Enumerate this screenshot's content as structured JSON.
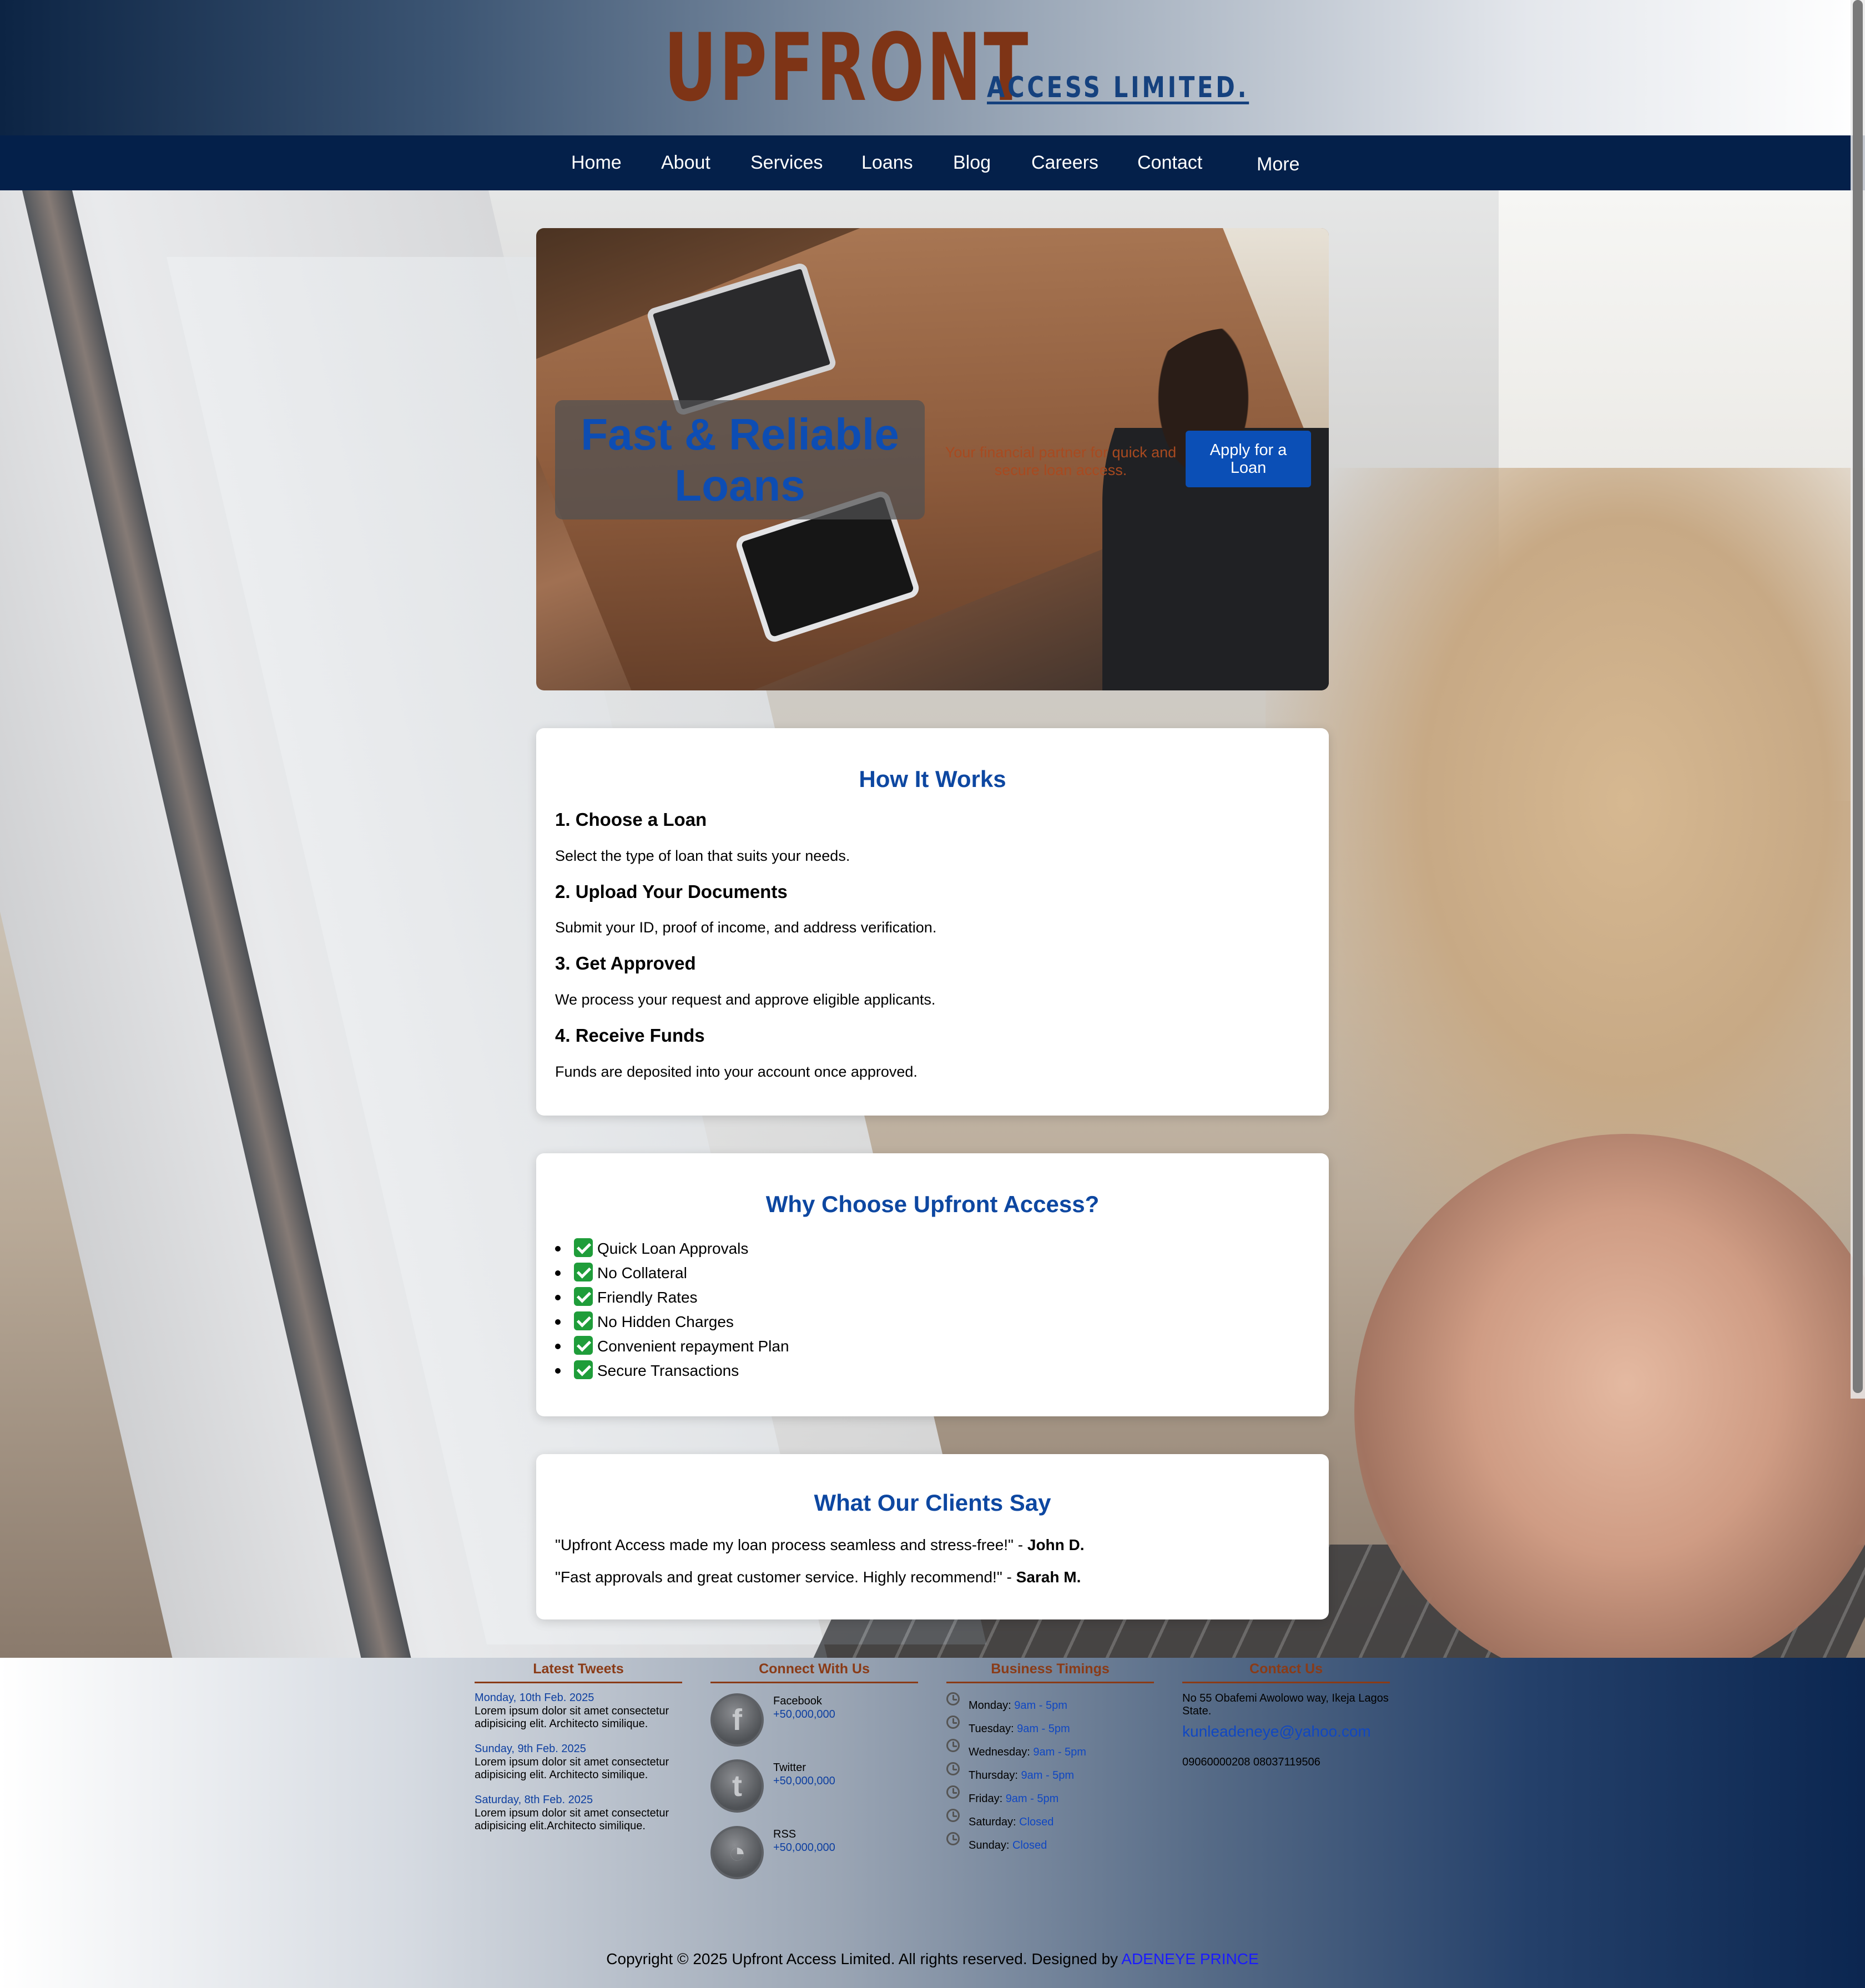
{
  "brand": {
    "name": "UPFRONT",
    "sub": "ACCESS LIMITED."
  },
  "nav": {
    "items": [
      {
        "label": "Home"
      },
      {
        "label": "About"
      },
      {
        "label": "Services"
      },
      {
        "label": "Loans"
      },
      {
        "label": "Blog"
      },
      {
        "label": "Careers"
      },
      {
        "label": "Contact"
      },
      {
        "label": "More"
      }
    ]
  },
  "hero": {
    "title": "Fast & Reliable Loans",
    "tagline": "Your financial partner for quick and secure loan access.",
    "button": "Apply for a Loan"
  },
  "how": {
    "title": "How It Works",
    "steps": [
      {
        "head": "1. Choose a Loan",
        "text": "Select the type of loan that suits your needs."
      },
      {
        "head": "2. Upload Your Documents",
        "text": "Submit your ID, proof of income, and address verification."
      },
      {
        "head": "3. Get Approved",
        "text": "We process your request and approve eligible applicants."
      },
      {
        "head": "4. Receive Funds",
        "text": "Funds are deposited into your account once approved."
      }
    ]
  },
  "why": {
    "title": "Why Choose Upfront Access?",
    "items": [
      "Quick Loan Approvals",
      "No Collateral",
      "Friendly Rates",
      "No Hidden Charges",
      "Convenient repayment Plan",
      "Secure Transactions"
    ]
  },
  "testimonials": {
    "title": "What Our Clients Say",
    "quotes": [
      {
        "text": "\"Upfront Access made my loan process seamless and stress-free!\" - ",
        "author": "John D."
      },
      {
        "text": "\"Fast approvals and great customer service. Highly recommend!\" - ",
        "author": "Sarah M."
      }
    ]
  },
  "footer": {
    "tweets": {
      "title": "Latest Tweets",
      "items": [
        {
          "date": "Monday, 10th Feb. 2025",
          "text": "Lorem ipsum dolor sit amet consectetur adipisicing elit. Architecto similique."
        },
        {
          "date": "Sunday, 9th Feb. 2025",
          "text": "Lorem ipsum dolor sit amet consectetur adipisicing elit. Architecto similique."
        },
        {
          "date": "Saturday, 8th Feb. 2025",
          "text": "Lorem ipsum dolor sit amet consectetur adipisicing elit.Architecto similique."
        }
      ]
    },
    "connect": {
      "title": "Connect With Us",
      "items": [
        {
          "name": "Facebook",
          "count": "+50,000,000",
          "glyph": "f",
          "icon": "facebook-icon"
        },
        {
          "name": "Twitter",
          "count": "+50,000,000",
          "glyph": "t",
          "icon": "twitter-icon"
        },
        {
          "name": "RSS",
          "count": "+50,000,000",
          "glyph": "◔",
          "icon": "rss-icon"
        }
      ]
    },
    "timings": {
      "title": "Business Timings",
      "items": [
        {
          "day": "Monday:",
          "hours": "9am - 5pm"
        },
        {
          "day": "Tuesday:",
          "hours": "9am - 5pm"
        },
        {
          "day": "Wednesday:",
          "hours": "9am - 5pm"
        },
        {
          "day": "Thursday:",
          "hours": "9am - 5pm"
        },
        {
          "day": "Friday:",
          "hours": "9am - 5pm"
        },
        {
          "day": "Saturday:",
          "hours": "Closed"
        },
        {
          "day": "Sunday:",
          "hours": "Closed"
        }
      ]
    },
    "contact": {
      "title": "Contact Us",
      "address": "No 55 Obafemi Awolowo way, Ikeja Lagos State.",
      "email": "kunleadeneye@yahoo.com",
      "phone": "09060000208 08037119506"
    },
    "copyright": "Copyright © 2025 Upfront Access Limited. All rights reserved. Designed by ",
    "designer": "ADENEYE PRINCE"
  },
  "colors": {
    "nav_bg": "#04204a",
    "brand_orange": "#7e3416",
    "accent_blue": "#0d47a1",
    "button_blue": "#0b4fb6"
  }
}
